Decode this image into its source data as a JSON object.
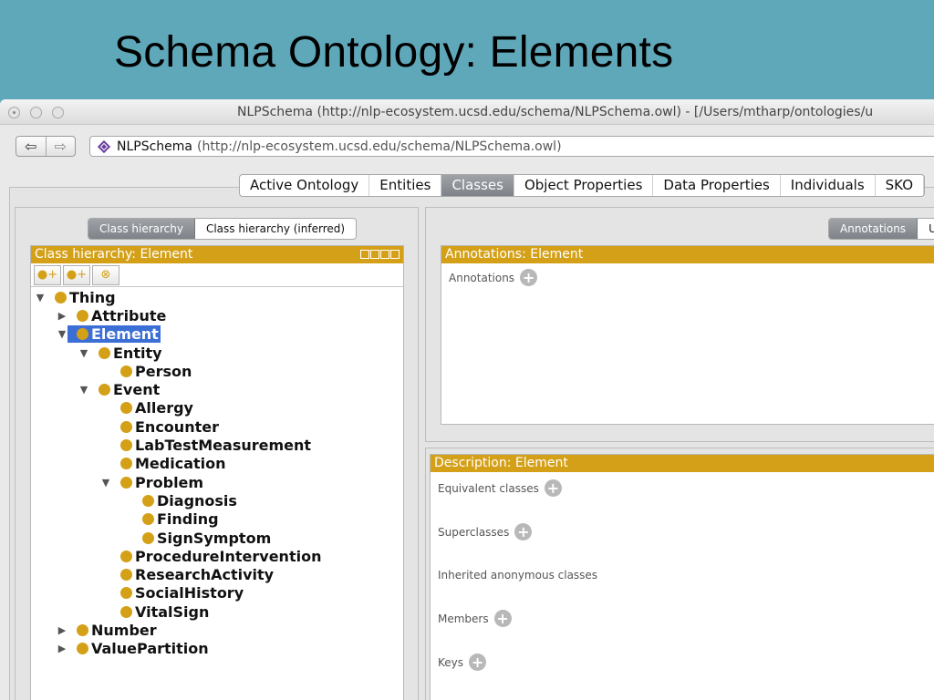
{
  "slide": {
    "title": "Schema Ontology: Elements"
  },
  "window": {
    "title": "NLPSchema (http://nlp-ecosystem.ucsd.edu/schema/NLPSchema.owl) - [/Users/mtharp/ontologies/u"
  },
  "toolbar": {
    "back_icon": "⇦",
    "forward_icon": "⇨",
    "ontology_name": "NLPSchema",
    "ontology_iri": "(http://nlp-ecosystem.ucsd.edu/schema/NLPSchema.owl)"
  },
  "tabs": [
    "Active Ontology",
    "Entities",
    "Classes",
    "Object Properties",
    "Data Properties",
    "Individuals",
    "SKO"
  ],
  "left": {
    "subtabs": [
      "Class hierarchy",
      "Class hierarchy (inferred)"
    ],
    "header": "Class hierarchy: Element",
    "tree": [
      {
        "label": "Thing",
        "expanded": "open"
      },
      {
        "label": "Attribute",
        "expanded": "closed"
      },
      {
        "label": "Element",
        "expanded": "open",
        "selected": true
      },
      {
        "label": "Entity",
        "expanded": "open"
      },
      {
        "label": "Person",
        "expanded": "none"
      },
      {
        "label": "Event",
        "expanded": "open"
      },
      {
        "label": "Allergy",
        "expanded": "none"
      },
      {
        "label": "Encounter",
        "expanded": "none"
      },
      {
        "label": "LabTestMeasurement",
        "expanded": "none"
      },
      {
        "label": "Medication",
        "expanded": "none"
      },
      {
        "label": "Problem",
        "expanded": "open"
      },
      {
        "label": "Diagnosis",
        "expanded": "none"
      },
      {
        "label": "Finding",
        "expanded": "none"
      },
      {
        "label": "SignSymptom",
        "expanded": "none"
      },
      {
        "label": "ProcedureIntervention",
        "expanded": "none"
      },
      {
        "label": "ResearchActivity",
        "expanded": "none"
      },
      {
        "label": "SocialHistory",
        "expanded": "none"
      },
      {
        "label": "VitalSign",
        "expanded": "none"
      },
      {
        "label": "Number",
        "expanded": "closed"
      },
      {
        "label": "ValuePartition",
        "expanded": "closed"
      }
    ]
  },
  "right": {
    "subtabs": [
      "Annotations",
      "U"
    ],
    "annotations_header": "Annotations: Element",
    "annotations_label": "Annotations",
    "description_header": "Description: Element",
    "description_items": [
      "Equivalent classes",
      "Superclasses",
      "Inherited anonymous classes",
      "Members",
      "Keys"
    ]
  },
  "colors": {
    "accent": "#d4a017",
    "selection": "#3b6fd6",
    "background": "#5fa8ba"
  }
}
